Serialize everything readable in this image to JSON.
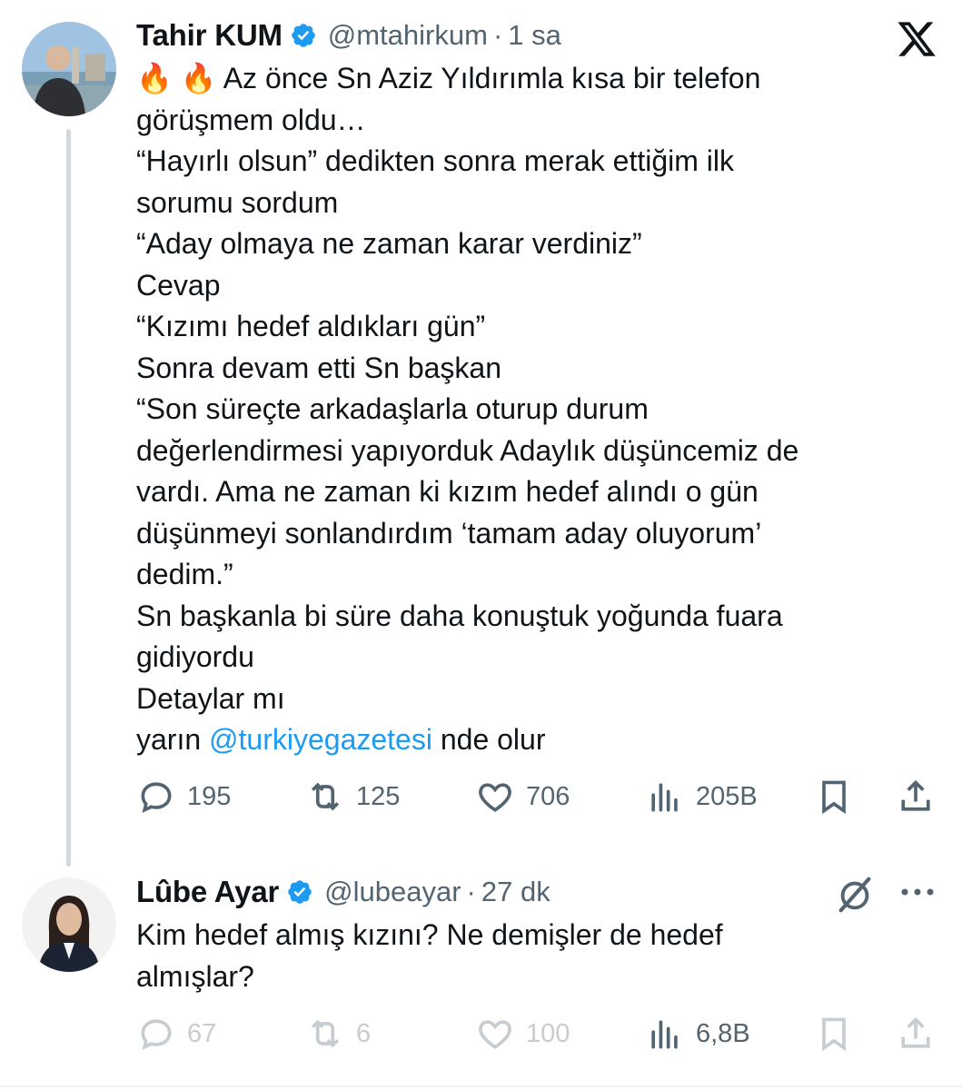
{
  "tweet1": {
    "name": "Tahir KUM",
    "handle": "@mtahirkum",
    "sep": "·",
    "time": "1 sa",
    "lines": [
      "🔥 🔥  Az önce Sn Aziz Yıldırımla kısa bir telefon",
      "görüşmem oldu…",
      "“Hayırlı olsun” dedikten sonra merak ettiğim ilk",
      "sorumu sordum",
      "“Aday olmaya ne zaman karar verdiniz”",
      "Cevap",
      "“Kızımı hedef aldıkları gün”",
      "Sonra devam etti Sn başkan",
      "“Son süreçte arkadaşlarla oturup durum",
      "değerlendirmesi yapıyorduk Adaylık düşüncemiz de",
      "vardı. Ama ne zaman ki kızım hedef alındı o gün",
      "düşünmeyi sonlandırdım ‘tamam aday oluyorum’",
      "dedim.”",
      "Sn başkanla bi süre daha konuştuk yoğunda fuara",
      "gidiyordu",
      "Detaylar mı"
    ],
    "last_line_prefix": "yarın ",
    "mention": "@turkiyegazetesi",
    "last_line_suffix": " nde olur",
    "replies": "195",
    "reposts": "125",
    "likes": "706",
    "views": "205B"
  },
  "tweet2": {
    "name": "Lûbe Ayar",
    "handle": "@lubeayar",
    "sep": "·",
    "time": "27 dk",
    "lines": [
      "Kim hedef almış kızını? Ne demişler de hedef",
      "almışlar?"
    ],
    "replies": "67",
    "reposts": "6",
    "likes": "100",
    "views": "6,8B"
  },
  "colors": {
    "text": "#0f1419",
    "secondary": "#536471",
    "link": "#1d9bf0",
    "verified": "#1d9bf0",
    "thread_line": "#cfd9de"
  },
  "icons": [
    "x-logo-icon",
    "verified-badge-icon",
    "reply-icon",
    "repost-icon",
    "like-icon",
    "views-icon",
    "bookmark-icon",
    "share-icon",
    "grok-icon",
    "more-icon"
  ]
}
